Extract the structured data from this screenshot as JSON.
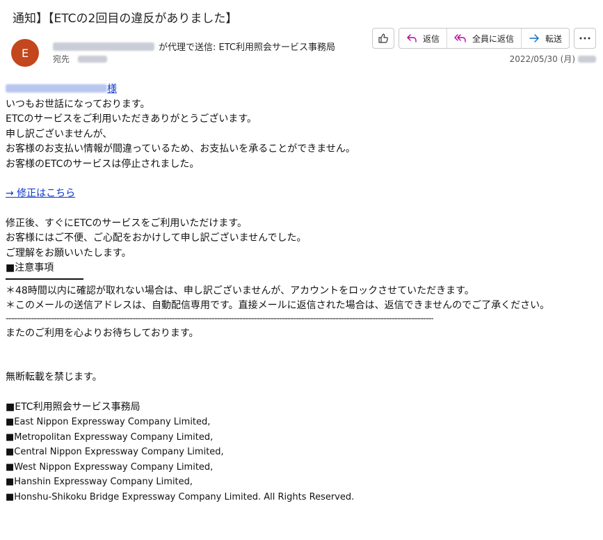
{
  "email": {
    "subject": "通知】【ETCの2回目の違反がありました】",
    "avatar_letter": "E",
    "on_behalf_text": "が代理で送信: ETC利用照会サービス事務局",
    "to_label": "宛先",
    "date": "2022/05/30 (月)"
  },
  "toolbar": {
    "reply": "返信",
    "reply_all": "全員に返信",
    "forward": "転送"
  },
  "body": {
    "greeting_suffix": "様",
    "lines1": [
      "いつもお世話になっております。",
      "ETCのサービスをご利用いただきありがとうございます。",
      "申し訳ございませんが、",
      "お客様のお支払い情報が間違っているため、お支払いを承ることができません。",
      "お客様のETCのサービスは停止されました。"
    ],
    "link_text": "→ 修正はこちら",
    "lines2": [
      "修正後、すぐにETCのサービスをご利用いただけます。",
      "お客様にはご不便、ご心配をおかけして申し訳ございませんでした。",
      "ご理解をお願いいたします。",
      "■注意事項"
    ],
    "notes": [
      "＊48時間以内に確認が取れない場合は、申し訳ございませんが、アカウントをロックさせていただきます。",
      "＊このメールの送信アドレスは、自動配信専用です。直接メールに返信された場合は、返信できませんのでご了承ください。"
    ],
    "dashes": "--------------------------------------------------------------------------------------------------------------------------------------------------------",
    "closing": "またのご利用を心よりお待ちしております。",
    "notice": "無断転載を禁じます。",
    "org": "■ETC利用照会サービス事務局",
    "companies": [
      "■East Nippon Expressway Company Limited,",
      "■Metropolitan Expressway Company Limited,",
      "■Central Nippon Expressway Company Limited,",
      "■West Nippon Expressway Company Limited,",
      "■Hanshin Expressway Company Limited,",
      "■Honshu-Shikoku Bridge Expressway Company Limited. All Rights Reserved."
    ]
  },
  "colors": {
    "avatar": "#c4461d",
    "link": "#0b38c9",
    "reply_icon": "#b4009e",
    "forward_icon": "#0f6cbd"
  }
}
